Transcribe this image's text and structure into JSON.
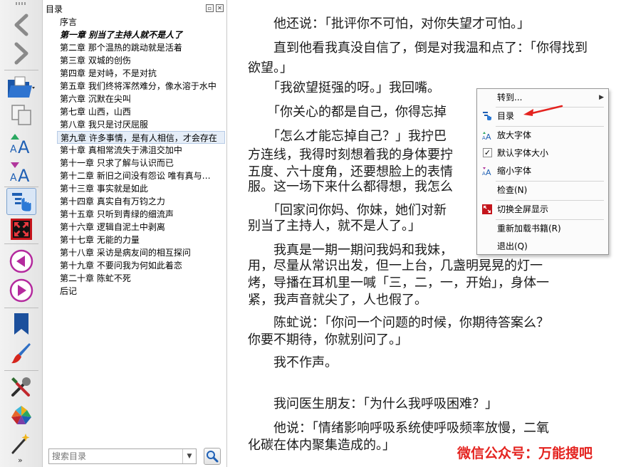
{
  "toolbar": {
    "buttons": [
      {
        "name": "back-arrow-icon"
      },
      {
        "name": "forward-arrow-icon"
      },
      {
        "name": "open-book-icon"
      },
      {
        "name": "copy-icon"
      },
      {
        "name": "increase-font-icon"
      },
      {
        "name": "decrease-font-icon"
      },
      {
        "name": "toc-toggle-icon"
      },
      {
        "name": "fullscreen-icon"
      },
      {
        "name": "previous-page-icon"
      },
      {
        "name": "next-page-icon"
      },
      {
        "name": "bookmark-icon"
      },
      {
        "name": "paint-brush-icon"
      },
      {
        "name": "tools-icon"
      },
      {
        "name": "color-wheel-icon"
      },
      {
        "name": "magic-wand-icon"
      }
    ],
    "more_label": "»"
  },
  "toc": {
    "title": "目录",
    "items": [
      "序言",
      "第一章  别当了主持人就不是人了",
      "第二章  那个温热的跳动就是活着",
      "第三章  双城的创伤",
      "第四章  是对峙，不是对抗",
      "第五章  我们终将浑然难分，像水溶于水中",
      "第六章  沉默在尖叫",
      "第七章  山西，山西",
      "第八章  我只是讨厌屈服",
      "第九章  许多事情，是有人相信，才会存在",
      "第十章  真相常流失于沸沮交加中",
      "第十一章  只求了解与认识而已",
      "第十二章  新旧之间没有怨讼  唯有真与…",
      "第十三章  事实就是如此",
      "第十四章  真实自有万钧之力",
      "第十五章  只听到青绿的细流声",
      "第十六章  逻辑自泥土中剥离",
      "第十七章  无能的力量",
      "第十八章  采访是病友间的相互探问",
      "第十九章  不要问我为何如此着恋",
      "第二十章  陈虻不死",
      "后记"
    ],
    "search_placeholder": "搜索目录"
  },
  "reader": {
    "paragraphs": [
      "　　他还说：「批评你不可怕，对你失望才可怕。」",
      "　　直到他看我真没自信了，倒是对我温和点了：「你得找到欲望。」",
      "　　「我欲望挺强的呀。」我回嘴。",
      "　　「你关心的都是自己，你得忘掉",
      "　　「怎么才能忘掉自己？」我拧巴",
      "方连线，我得时刻想着我的身体要拧",
      "五度、六十度角，还要想脸上的表情",
      "服。这一场下来什么都得想，我怎么",
      "　　「回家问你妈、你妹，她们对新",
      "别当了主持人，就不是人了。」",
      "　　我真是一期一期问我妈和我妹，",
      "用，尽量从常识出发，但一上台，几盏明晃晃的灯一",
      "烤，导播在耳机里一喊「三，二，一，开始」，身体一",
      "紧，我声音就尖了，人也假了。",
      "　　陈虻说：「你问一个问题的时候，你期待答案么？",
      "你要不期待，你就别问了。」",
      "　　我不作声。",
      "　　我问医生朋友：「为什么我呼吸困难？」",
      "　　他说：「情绪影响呼吸系统使呼吸频率放慢，二氧",
      "化碳在体内聚集造成的。」"
    ],
    "watermark": "微信公众号：万能搜吧"
  },
  "context_menu": {
    "items": [
      {
        "label": "转到...",
        "icon": "",
        "has_submenu": true
      },
      {
        "label": "目录",
        "icon": "toc-icon"
      },
      {
        "label": "放大字体",
        "icon": "increase-font-icon"
      },
      {
        "label": "默认字体大小",
        "icon": "checkbox-checked-icon"
      },
      {
        "label": "缩小字体",
        "icon": "decrease-font-icon"
      },
      {
        "label": "检查(N)",
        "icon": ""
      },
      {
        "label": "切换全屏显示",
        "icon": "fullscreen-icon"
      },
      {
        "label": "重新加载书籍(R)",
        "icon": ""
      },
      {
        "label": "退出(Q)",
        "icon": ""
      }
    ]
  },
  "colors": {
    "accent_blue": "#1e5fb4",
    "watermark_red": "#e4231f",
    "selection_bg": "#e6eef8"
  }
}
